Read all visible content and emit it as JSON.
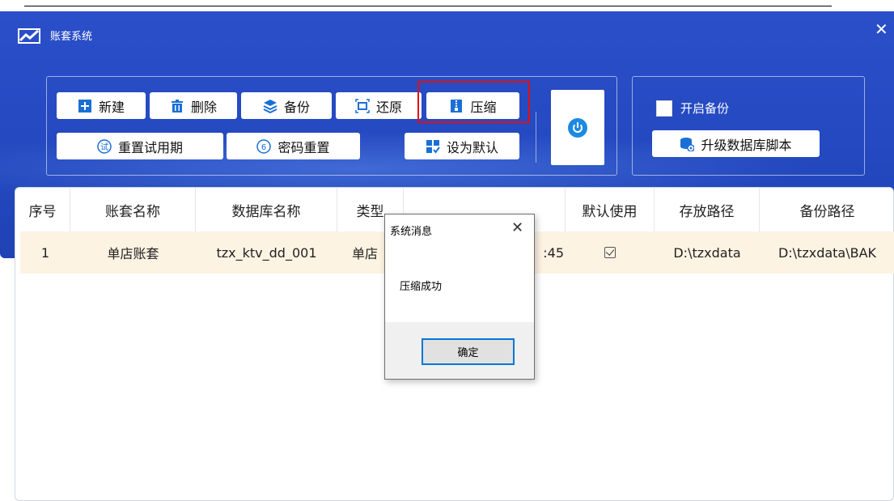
{
  "window": {
    "title": "账套系统",
    "close_glyph": "✕"
  },
  "toolbar": {
    "new_label": "新建",
    "delete_label": "删除",
    "backup_label": "备份",
    "restore_label": "还原",
    "compress_label": "压缩",
    "reset_trial_label": "重置试用期",
    "reset_password_label": "密码重置",
    "set_default_label": "设为默认",
    "enable_backup_label": "开启备份",
    "enable_backup_checked": false,
    "upgrade_script_label": "升级数据库脚本",
    "trial_icon_text": "试",
    "password_icon_text": "6"
  },
  "table": {
    "columns": [
      "序号",
      "账套名称",
      "数据库名称",
      "类型",
      "",
      "默认使用",
      "存放路径",
      "备份路径"
    ],
    "rows": [
      {
        "index": "1",
        "name": "单店账套",
        "db": "tzx_ktv_dd_001",
        "type": "单店",
        "time_fragment": ":45",
        "default": true,
        "path": "D:\\tzxdata",
        "backup_path": "D:\\tzxdata\\BAK"
      }
    ]
  },
  "dialog": {
    "title": "系统消息",
    "close_glyph": "✕",
    "message": "压缩成功",
    "ok_label": "确定"
  },
  "colors": {
    "titlebar": "#2348bf",
    "accent_blue": "#1c8ae0",
    "highlight_red": "#e01010",
    "row_highlight": "#fdf3e3"
  }
}
